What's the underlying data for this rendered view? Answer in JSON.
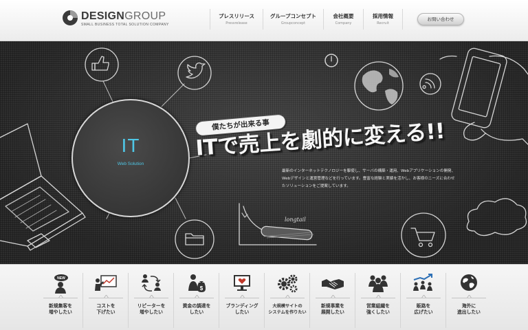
{
  "header": {
    "logo_main": "DESIGN",
    "logo_light": "GROUP",
    "logo_tagline": "SMALL BUSINESS TOTAL SOLUTION COMPANY",
    "nav": [
      {
        "label": "プレスリリース",
        "sub": "Pressrelease"
      },
      {
        "label": "グループコンセプト",
        "sub": "Groupconcept"
      },
      {
        "label": "会社概要",
        "sub": "Company"
      },
      {
        "label": "採用情報",
        "sub": "Recruit"
      }
    ],
    "contact_label": "お問い合わせ"
  },
  "hero": {
    "circle_title": "IT",
    "circle_subtitle": "Web Solution",
    "badge": "僕たちが出来る事",
    "headline": "ITで売上を劇的に変える!!",
    "description": "最新のインターネットテクノロジーを駆使し、サーバの構築・運用、Webアプリケーションの開発、Webデザインと運営管理などを行っています。豊富な経験と実績を活かし、お客様のニーズに合わせたソリューションをご提案しています。",
    "sketch_label": "longtail"
  },
  "services": [
    {
      "icon": "new-badge-icon",
      "text": "新規集客を\n増やしたい"
    },
    {
      "icon": "presentation-icon",
      "text": "コストを\n下げたい"
    },
    {
      "icon": "repeat-users-icon",
      "text": "リピーターを\n増やしたい"
    },
    {
      "icon": "money-bag-icon",
      "text": "資金の調達を\nしたい"
    },
    {
      "icon": "branding-monitor-icon",
      "text": "ブランディング\nしたい"
    },
    {
      "icon": "gears-icon",
      "text": "大規模サイトの\nシステムを作りたい"
    },
    {
      "icon": "handshake-icon",
      "text": "新規事業を\n展開したい"
    },
    {
      "icon": "team-icon",
      "text": "営業組織を\n強くしたい"
    },
    {
      "icon": "growth-people-icon",
      "text": "販路を\n広げたい"
    },
    {
      "icon": "globe-icon",
      "text": "海外に\n進出したい"
    }
  ],
  "colors": {
    "accent": "#4fc7e6",
    "hero_bg": "#3c3c3c"
  }
}
